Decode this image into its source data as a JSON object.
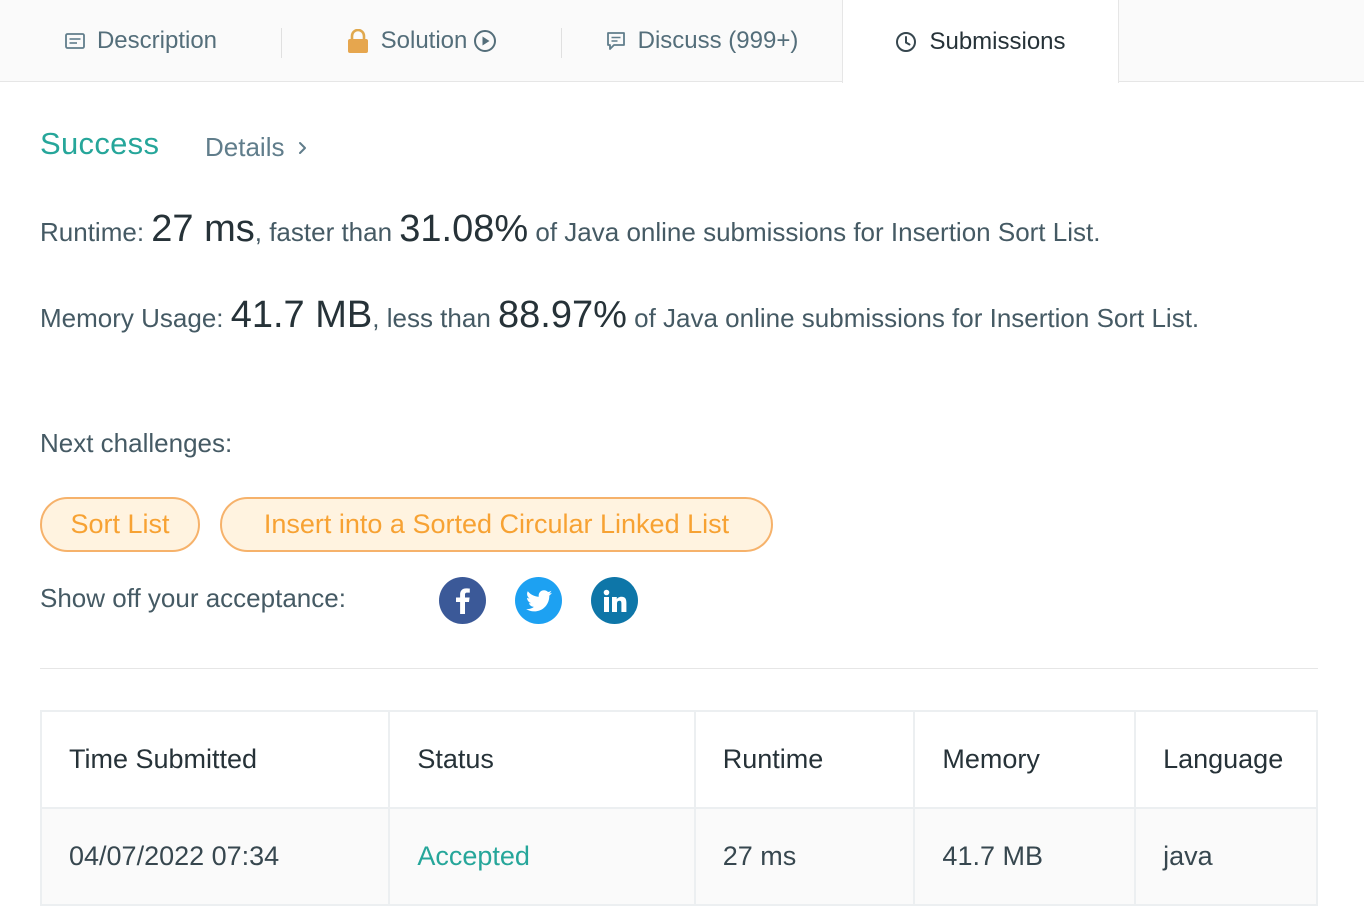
{
  "tabs": {
    "description": "Description",
    "solution": "Solution",
    "discuss": "Discuss (999+)",
    "submissions": "Submissions"
  },
  "result": {
    "status": "Success",
    "details": "Details"
  },
  "runtime": {
    "label": "Runtime: ",
    "value": "27 ms",
    "mid": ", faster than ",
    "percent": "31.08%",
    "tail": " of Java online submissions for Insertion Sort List."
  },
  "memory": {
    "label": "Memory Usage: ",
    "value": "41.7 MB",
    "mid": ", less than ",
    "percent": "88.97%",
    "tail": " of Java online submissions for Insertion Sort List."
  },
  "next": {
    "title": "Next challenges:",
    "items": [
      "Sort List",
      "Insert into a Sorted Circular Linked List"
    ]
  },
  "share": {
    "label": "Show off your acceptance:",
    "icons": [
      "facebook-icon",
      "twitter-icon",
      "linkedin-icon"
    ]
  },
  "table": {
    "headers": [
      "Time Submitted",
      "Status",
      "Runtime",
      "Memory",
      "Language"
    ],
    "rows": [
      [
        "04/07/2022 07:34",
        "Accepted",
        "27 ms",
        "41.7 MB",
        "java"
      ]
    ]
  },
  "colors": {
    "success": "#26a69a",
    "chip_text": "#f7a233",
    "chip_border": "#f6b26b",
    "facebook": "#3b5998",
    "twitter": "#1da1f2",
    "linkedin": "#0e76a8"
  }
}
